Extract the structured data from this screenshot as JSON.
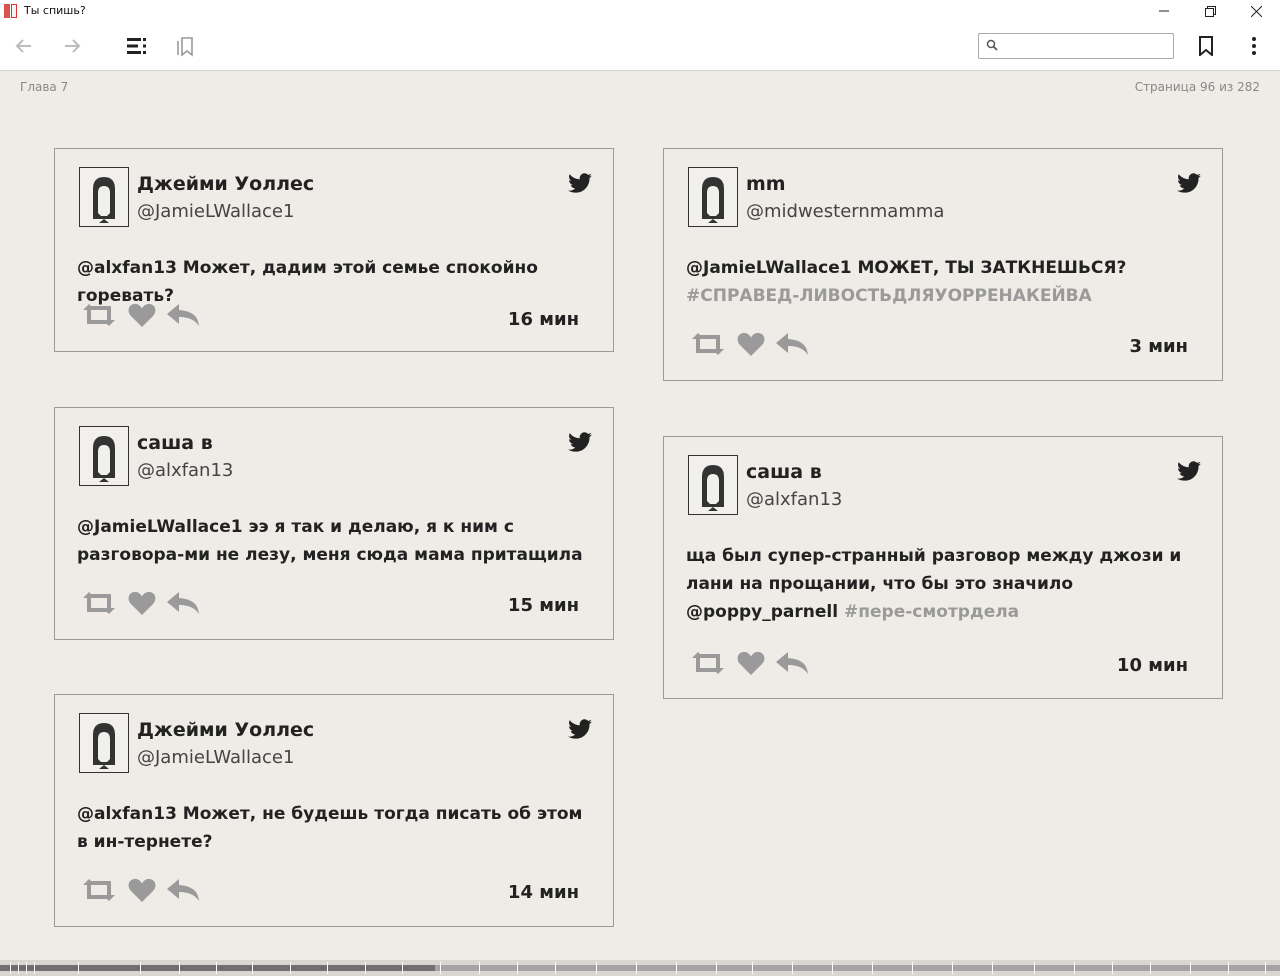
{
  "window": {
    "title": "Ты спишь?"
  },
  "toolbar": {
    "search_placeholder": ""
  },
  "header": {
    "chapter": "Глава 7",
    "page": "Страница 96 из 282"
  },
  "tweets_left": [
    {
      "name": "Джейми Уоллес",
      "handle": "@JamieLWallace1",
      "text": "@alxfan13 Может, дадим этой семье спокойно горевать?",
      "hashtag": "",
      "time": "16 мин"
    },
    {
      "name": "саша в",
      "handle": "@alxfan13",
      "text": "@JamieLWallace1 ээ я так и делаю, я к ним с разговора-ми не лезу, меня сюда мама притащила",
      "hashtag": "",
      "time": "15 мин"
    },
    {
      "name": "Джейми Уоллес",
      "handle": "@JamieLWallace1",
      "text": "@alxfan13 Может, не будешь тогда писать об этом в ин-тернете?",
      "hashtag": "",
      "time": "14 мин"
    }
  ],
  "tweets_right": [
    {
      "name": "mm",
      "handle": "@midwesternmamma",
      "text": "@JamieLWallace1 МОЖЕТ, ТЫ ЗАТКНЕШЬСЯ?",
      "hashtag": "#СПРАВЕД-ЛИВОСТЬДЛЯУОРРЕНАКЕЙВА",
      "time": "3 мин"
    },
    {
      "name": "саша в",
      "handle": "@alxfan13",
      "text": "ща был супер-странный разговор между джози и лани на прощании, что бы это значило @poppy_parnell",
      "hashtag": "#пере-смотрдела",
      "time": "10 мин"
    }
  ],
  "progress": {
    "page": 96,
    "total": 282,
    "fraction": 0.34
  },
  "colors": {
    "background": "#efece7",
    "text": "#222222",
    "hashtag": "#9a9a9a",
    "icon_gray": "#9a9a9a"
  },
  "icons": [
    "back-icon",
    "forward-icon",
    "toc-icon",
    "bookmarks-list-icon",
    "search-icon",
    "bookmark-icon",
    "more-icon",
    "twitter-bird-icon",
    "retweet-icon",
    "heart-icon",
    "reply-icon"
  ]
}
